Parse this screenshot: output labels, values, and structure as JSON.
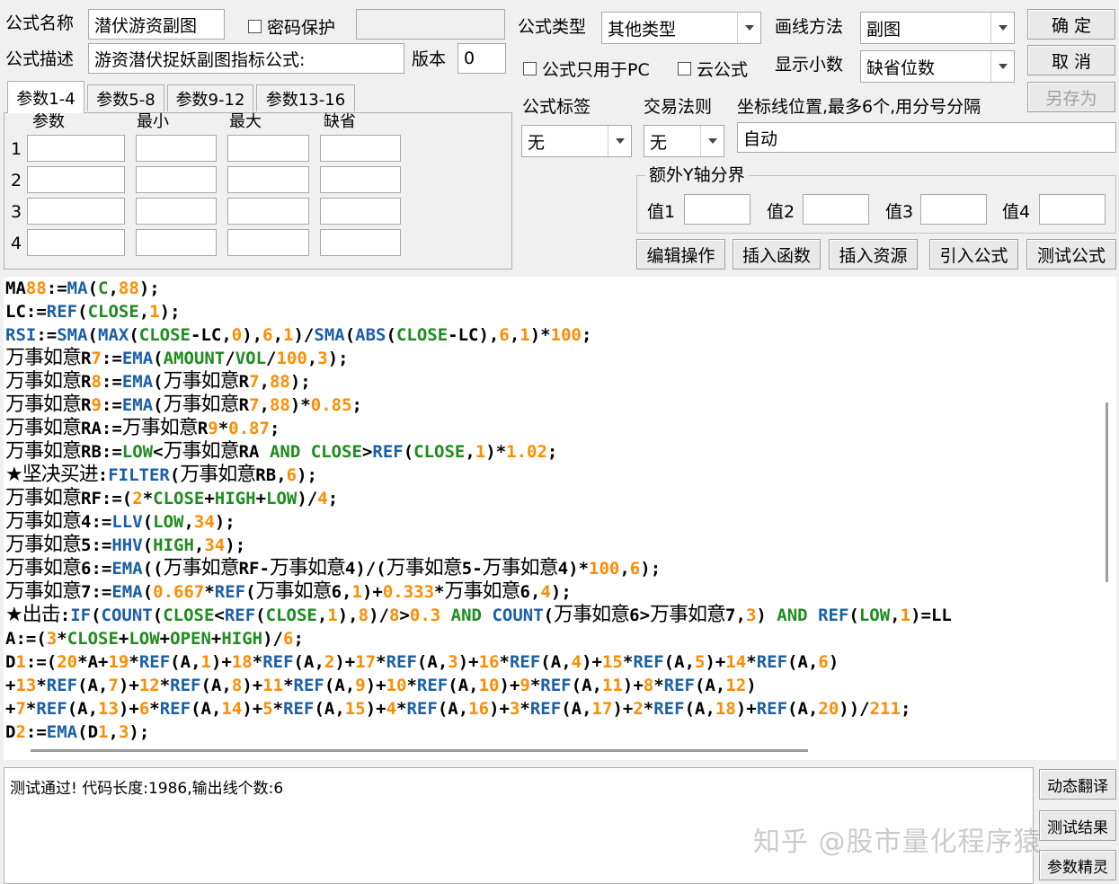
{
  "header": {
    "name_label": "公式名称",
    "name_value": "潜伏游资副图",
    "password_label": "密码保护",
    "desc_label": "公式描述",
    "desc_value": "游资潜伏捉妖副图指标公式:",
    "version_label": "版本",
    "version_value": "0",
    "type_label": "公式类型",
    "type_value": "其他类型",
    "draw_label": "画线方法",
    "draw_value": "副图",
    "pc_only_label": "公式只用于PC",
    "cloud_label": "云公式",
    "decimal_label": "显示小数",
    "decimal_value": "缺省位数"
  },
  "buttons": {
    "ok": "确 定",
    "cancel": "取 消",
    "save_as": "另存为",
    "edit": "编辑操作",
    "insert_func": "插入函数",
    "insert_res": "插入资源",
    "import": "引入公式",
    "test": "测试公式",
    "dyn_translate": "动态翻译",
    "test_result": "测试结果",
    "param_wizard": "参数精灵"
  },
  "params": {
    "tabs": [
      "参数1-4",
      "参数5-8",
      "参数9-12",
      "参数13-16"
    ],
    "active_tab": 0,
    "columns": [
      "参数",
      "最小",
      "最大",
      "缺省"
    ],
    "rows": [
      "1",
      "2",
      "3",
      "4"
    ]
  },
  "options": {
    "tag_label": "公式标签",
    "tag_value": "无",
    "rule_label": "交易法则",
    "rule_value": "无",
    "axis_label": "坐标线位置,最多6个,用分号分隔",
    "axis_value": "自动",
    "extra_y_label": "额外Y轴分界",
    "values": [
      "值1",
      "值2",
      "值3",
      "值4"
    ]
  },
  "code_lines": [
    "MA88:=MA(C,88);",
    "LC:=REF(CLOSE,1);",
    "RSI:=SMA(MAX(CLOSE-LC,0),6,1)/SMA(ABS(CLOSE-LC),6,1)*100;",
    "万事如意R7:=EMA(AMOUNT/VOL/100,3);",
    "万事如意R8:=EMA(万事如意R7,88);",
    "万事如意R9:=EMA(万事如意R7,88)*0.85;",
    "万事如意RA:=万事如意R9*0.87;",
    "万事如意RB:=LOW<万事如意RA AND CLOSE>REF(CLOSE,1)*1.02;",
    "★坚决买进:FILTER(万事如意RB,6);",
    "万事如意RF:=(2*CLOSE+HIGH+LOW)/4;",
    "万事如意4:=LLV(LOW,34);",
    "万事如意5:=HHV(HIGH,34);",
    "万事如意6:=EMA((万事如意RF-万事如意4)/(万事如意5-万事如意4)*100,6);",
    "万事如意7:=EMA(0.667*REF(万事如意6,1)+0.333*万事如意6,4);",
    "★出击:IF(COUNT(CLOSE<REF(CLOSE,1),8)/8>0.3 AND COUNT(万事如意6>万事如意7,3) AND REF(LOW,1)=LL",
    "A:=(3*CLOSE+LOW+OPEN+HIGH)/6;",
    "D1:=(20*A+19*REF(A,1)+18*REF(A,2)+17*REF(A,3)+16*REF(A,4)+15*REF(A,5)+14*REF(A,6)",
    "+13*REF(A,7)+12*REF(A,8)+11*REF(A,9)+10*REF(A,10)+9*REF(A,11)+8*REF(A,12)",
    "+7*REF(A,13)+6*REF(A,14)+5*REF(A,15)+4*REF(A,16)+3*REF(A,17)+2*REF(A,18)+REF(A,20))/211;",
    "D2:=EMA(D1,3);"
  ],
  "output": {
    "message": "测试通过! 代码长度:1986,输出线个数:6"
  },
  "watermark": "知乎 @股市量化程序猿",
  "colors": {
    "function": "#1a5fa8",
    "number": "#ff8c00",
    "keyword": "#1e8c1e"
  }
}
